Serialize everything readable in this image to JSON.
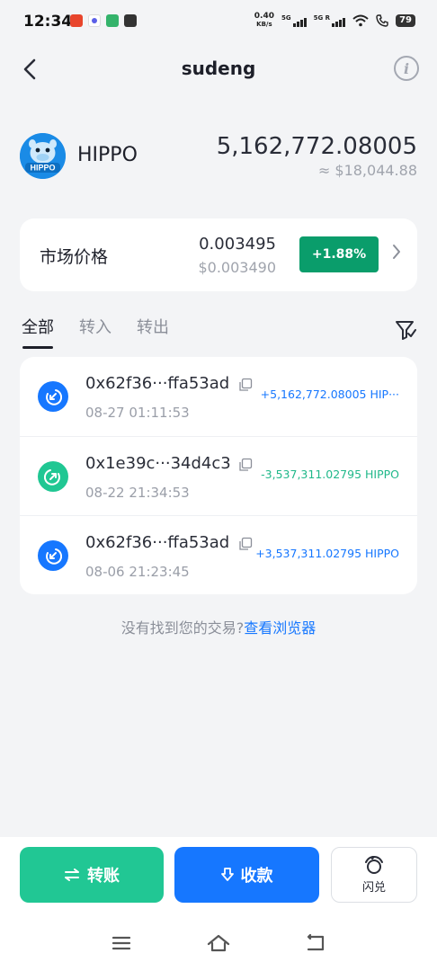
{
  "status_bar": {
    "time": "12:34",
    "net_speed_value": "0.40",
    "net_speed_unit": "KB/s",
    "sim1_label": "5G",
    "sim2_label": "5G R",
    "battery": "79"
  },
  "header": {
    "title": "sudeng"
  },
  "token": {
    "symbol": "HIPPO",
    "logo_text": "HIPPO",
    "balance": "5,162,772.08005",
    "balance_usd": "≈ $18,044.88"
  },
  "market": {
    "label": "市场价格",
    "price": "0.003495",
    "price_usd": "$0.003490",
    "change": "+1.88%"
  },
  "tabs": [
    "全部",
    "转入",
    "转出"
  ],
  "transactions": [
    {
      "hash": "0x62f36···ffa53ad",
      "date": "08-27 01:11:53",
      "amount": "+5,162,772.08005 HIP···",
      "direction": "in"
    },
    {
      "hash": "0x1e39c···34d4c3",
      "date": "08-22 21:34:53",
      "amount": "-3,537,311.02795 HIPPO",
      "direction": "out"
    },
    {
      "hash": "0x62f36···ffa53ad",
      "date": "08-06 21:23:45",
      "amount": "+3,537,311.02795 HIPPO",
      "direction": "in"
    }
  ],
  "not_found": {
    "text": "没有找到您的交易?",
    "link": "查看浏览器"
  },
  "actions": {
    "transfer_label": "转账",
    "receive_label": "收款",
    "swap_label": "闪兑"
  },
  "colors": {
    "accent_blue": "#1677ff",
    "accent_green": "#21c794",
    "change_green": "#0a9d6b"
  }
}
